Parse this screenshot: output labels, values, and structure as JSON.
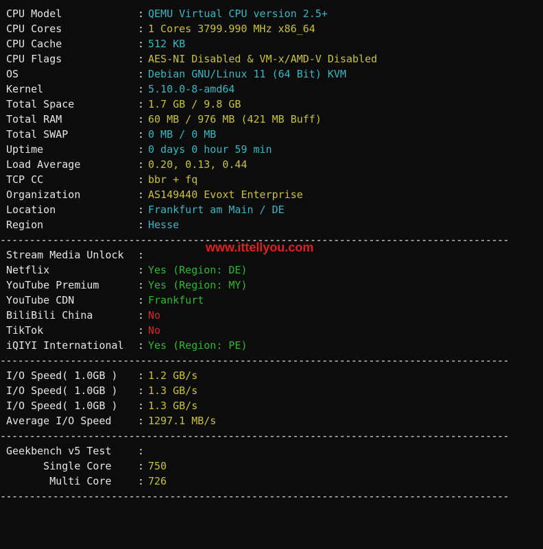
{
  "sysinfo": [
    {
      "label": "CPU Model",
      "value": "QEMU Virtual CPU version 2.5+",
      "color": "cyan"
    },
    {
      "label": "CPU Cores",
      "value": "1 Cores 3799.990 MHz x86_64",
      "color": "yellow"
    },
    {
      "label": "CPU Cache",
      "value": "512 KB",
      "color": "cyan"
    },
    {
      "label": "CPU Flags",
      "value": "AES-NI Disabled & VM-x/AMD-V Disabled",
      "color": "yellow"
    },
    {
      "label": "OS",
      "value": "Debian GNU/Linux 11 (64 Bit) KVM",
      "color": "cyan"
    },
    {
      "label": "Kernel",
      "value": "5.10.0-8-amd64",
      "color": "cyan"
    },
    {
      "label": "Total Space",
      "value": "1.7 GB / 9.8 GB",
      "color": "yellow"
    },
    {
      "label": "Total RAM",
      "value": "60 MB / 976 MB (421 MB Buff)",
      "color": "yellow"
    },
    {
      "label": "Total SWAP",
      "value": "0 MB / 0 MB",
      "color": "cyan"
    },
    {
      "label": "Uptime",
      "value": "0 days 0 hour 59 min",
      "color": "cyan"
    },
    {
      "label": "Load Average",
      "value": "0.20, 0.13, 0.44",
      "color": "yellow"
    },
    {
      "label": "TCP CC",
      "value": "bbr + fq",
      "color": "yellow"
    },
    {
      "label": "Organization",
      "value": "AS149440 Evoxt Enterprise",
      "color": "yellow"
    },
    {
      "label": "Location",
      "value": "Frankfurt am Main / DE",
      "color": "cyan"
    },
    {
      "label": "Region",
      "value": "Hesse",
      "color": "cyan"
    }
  ],
  "watermark": "www.ittellyou.com",
  "media_header": {
    "label": "Stream Media Unlock",
    "value": ""
  },
  "media": [
    {
      "label": "Netflix",
      "value": "Yes (Region: DE)",
      "color": "green"
    },
    {
      "label": "YouTube Premium",
      "value": "Yes (Region: MY)",
      "color": "green"
    },
    {
      "label": "YouTube CDN",
      "value": "Frankfurt",
      "color": "green"
    },
    {
      "label": "BiliBili China",
      "value": "No",
      "color": "red"
    },
    {
      "label": "TikTok",
      "value": "No",
      "color": "red"
    },
    {
      "label": "iQIYI International",
      "value": "Yes (Region: PE)",
      "color": "green"
    }
  ],
  "io": [
    {
      "label": "I/O Speed( 1.0GB )",
      "value": "1.2 GB/s",
      "color": "yellow"
    },
    {
      "label": "I/O Speed( 1.0GB )",
      "value": "1.3 GB/s",
      "color": "yellow"
    },
    {
      "label": "I/O Speed( 1.0GB )",
      "value": "1.3 GB/s",
      "color": "yellow"
    },
    {
      "label": "Average I/O Speed",
      "value": "1297.1 MB/s",
      "color": "yellow"
    }
  ],
  "geekbench_header": {
    "label": "Geekbench v5 Test",
    "value": ""
  },
  "geekbench": [
    {
      "label": "      Single Core",
      "value": "750",
      "color": "yellow"
    },
    {
      "label": "       Multi Core",
      "value": "726",
      "color": "yellow"
    }
  ],
  "separator": "----------------------------------------------------------------------------------------------------------------------------------------------------------------------------------------------------------------",
  "colon": ":"
}
